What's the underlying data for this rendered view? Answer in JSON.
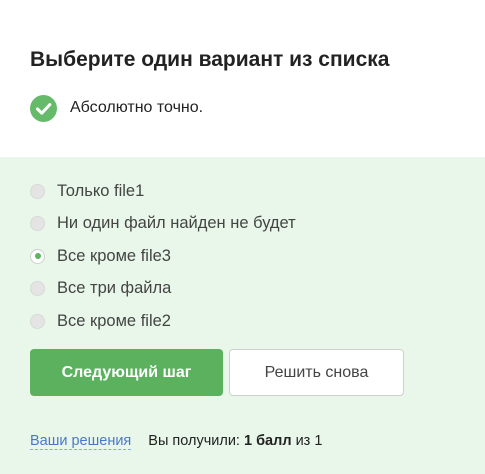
{
  "question": {
    "title": "Выберите один вариант из списка"
  },
  "feedback": {
    "icon": "check-circle-icon",
    "icon_color": "#66bb6a",
    "text": "Абсолютно точно."
  },
  "options": [
    {
      "label": "Только file1",
      "selected": false
    },
    {
      "label": "Ни один файл найден не будет",
      "selected": false
    },
    {
      "label": "Все кроме file3",
      "selected": true
    },
    {
      "label": "Все три файла",
      "selected": false
    },
    {
      "label": "Все кроме file2",
      "selected": false
    }
  ],
  "actions": {
    "next_label": "Следующий шаг",
    "retry_label": "Решить снова"
  },
  "footer": {
    "solutions_link": "Ваши решения",
    "score_prefix": "Вы получили:",
    "score_value": "1 балл",
    "score_suffix": "из 1"
  },
  "colors": {
    "accent": "#5cb15f",
    "panel_bg": "#e8f7e9",
    "link": "#4a77c9"
  }
}
